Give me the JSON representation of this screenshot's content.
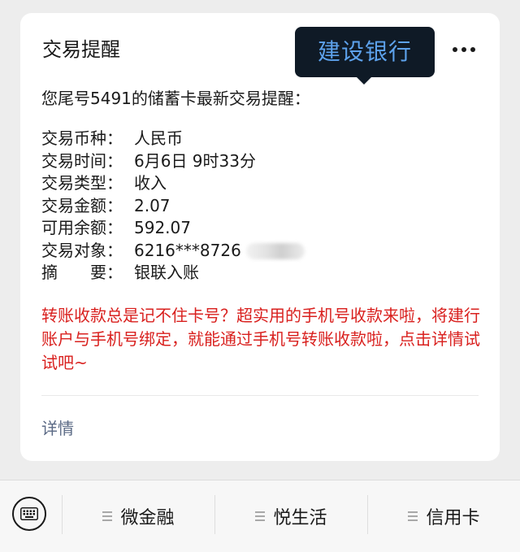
{
  "card": {
    "title": "交易提醒",
    "tooltip": "建设银行",
    "intro": "您尾号5491的储蓄卡最新交易提醒：",
    "rows": [
      {
        "label": "交易币种：",
        "value": "人民币"
      },
      {
        "label": "交易时间：",
        "value": "6月6日 9时33分"
      },
      {
        "label": "交易类型：",
        "value": "收入"
      },
      {
        "label": "交易金额：",
        "value": "2.07"
      },
      {
        "label": "可用余额：",
        "value": "592.07"
      },
      {
        "label": "交易对象：",
        "value": "6216***8726"
      },
      {
        "label": "摘　　要：",
        "value": "银联入账"
      }
    ],
    "promo": "转账收款总是记不住卡号？超实用的手机号收款来啦，将建行账户与手机号绑定，就能通过手机号转账收款啦，点击详情试试吧~",
    "details_label": "详情"
  },
  "bottom_menu": {
    "items": [
      {
        "label": "微金融"
      },
      {
        "label": "悦生活"
      },
      {
        "label": "信用卡"
      }
    ]
  },
  "icons": {
    "keyboard": "keyboard-icon",
    "more": "more-dots-icon",
    "menu": "menu-lines-icon"
  },
  "colors": {
    "promo_text": "#d9201e",
    "tooltip_bg": "#0f1a26",
    "tooltip_text": "#5da2ec",
    "link_text": "#5b6a85"
  }
}
